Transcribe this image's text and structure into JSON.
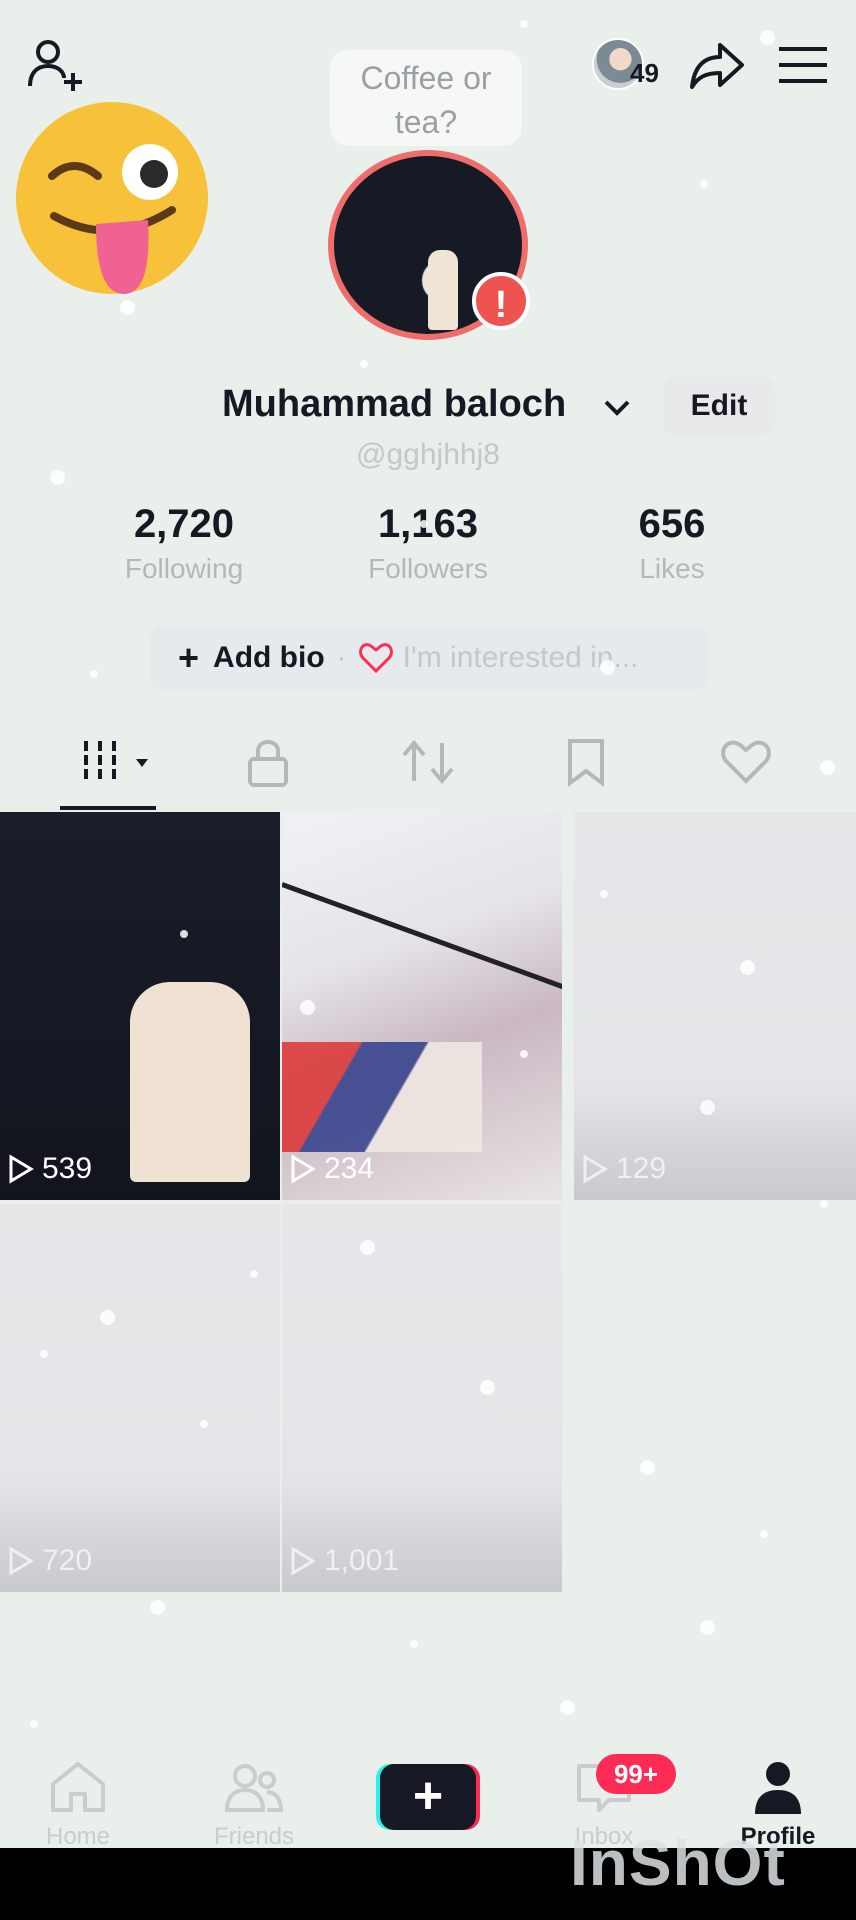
{
  "header": {
    "top_avatar_count": "49",
    "coffee_prompt": "Coffee or tea?"
  },
  "profile": {
    "name": "Muhammad baloch",
    "handle": "@gghjhhj8",
    "edit_label": "Edit",
    "alert_mark": "!"
  },
  "stats": [
    {
      "value": "2,720",
      "label": "Following"
    },
    {
      "value": "1,163",
      "label": "Followers"
    },
    {
      "value": "656",
      "label": "Likes"
    }
  ],
  "bio": {
    "add_label": "Add bio",
    "separator": "·",
    "interest_label": "I'm interested in..."
  },
  "tabs": [
    "videos-grid-icon",
    "lock-icon",
    "repost-icon",
    "bookmark-icon",
    "heart-icon"
  ],
  "videos": [
    {
      "views": "539"
    },
    {
      "views": "234"
    },
    {
      "views": "129"
    },
    {
      "views": "720"
    },
    {
      "views": "1,001"
    }
  ],
  "nav": {
    "home": "Home",
    "friends": "Friends",
    "create": "+",
    "inbox": "Inbox",
    "inbox_badge": "99+",
    "profile": "Profile"
  },
  "watermark": "InShOt",
  "colors": {
    "accent_red": "#fe2c55",
    "accent_cyan": "#25f4ee",
    "avatar_ring": "#ef6e6b"
  }
}
